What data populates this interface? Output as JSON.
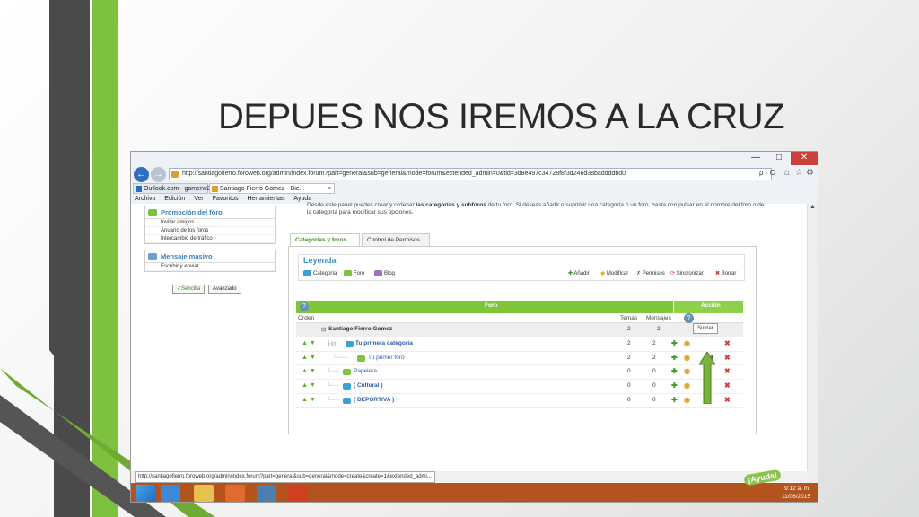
{
  "slide": {
    "title": "DEPUES NOS IREMOS A LA CRUZ"
  },
  "browser": {
    "address": "http://santiagofierro.foroweb.org/admin/index.forum?part=general&sub=general&mode=forum&extended_admin=0&tid=3d8e497c34728f8f3d246d38baddddbd0",
    "address_tools": "ρ - C",
    "tabs": [
      {
        "label": "Outlook.com - gamerw2015@..."
      },
      {
        "label": "Santiago Fierro Gomez - Bie..."
      }
    ],
    "menu": [
      "Archivo",
      "Edición",
      "Ver",
      "Favoritos",
      "Herramientas",
      "Ayuda"
    ],
    "status_url": "http://santiagofierro.foroweb.org/admin/index.forum?part=general&sub=general&mode=create&create=1&extended_admi..."
  },
  "sidebar": {
    "promo": {
      "title": "Promoción del foro",
      "items": [
        "Invitar amigos",
        "Anuario de los foros",
        "Intercambio de tráfico"
      ]
    },
    "mass": {
      "title": "Mensaje masivo",
      "items": [
        "Escribir y enviar"
      ]
    },
    "buttons": {
      "simple": "Sencilla",
      "advanced": "Avanzado"
    }
  },
  "intro": {
    "part1": "Desde este panel puedes crear y ordenar ",
    "bold": "las categorías y subforos",
    "part2": " de tu foro. Si deseas añadir o suprimir una categoría o un foro, basta con pulsar en el nombre del foro o de la categoría para modificar sus opciones."
  },
  "content_tabs": [
    "Categorías y foros",
    "Control de Permisos"
  ],
  "legend": {
    "title": "Leyenda",
    "types": [
      "Categoría",
      "Foro",
      "Blog"
    ],
    "actions": [
      "Añadir",
      "Modificar",
      "Permisos",
      "Sincronizar",
      "Borrar"
    ]
  },
  "table": {
    "header_foro": "Foro",
    "header_accion": "Acción",
    "col_orden": "Orden",
    "col_temas": "Temas",
    "col_mensajes": "Mensajes",
    "tooltip": "Sumar",
    "rows": [
      {
        "name": "Santiago Fierro Gomez",
        "temas": "2",
        "mensajes": "2"
      },
      {
        "name": "Tu primera categoría",
        "temas": "2",
        "mensajes": "2"
      },
      {
        "name": "Tu primer foro",
        "temas": "2",
        "mensajes": "2"
      },
      {
        "name": "Papelera",
        "temas": "0",
        "mensajes": "0"
      },
      {
        "name": "( Cultural )",
        "temas": "0",
        "mensajes": "0"
      },
      {
        "name": "( DEPORTIVA )",
        "temas": "0",
        "mensajes": "0"
      }
    ]
  },
  "taskbar": {
    "time": "9:12 a. m.",
    "date": "11/06/2015",
    "help_badge": "¡Ayuda!"
  },
  "colors": {
    "accent_green": "#7fc53a",
    "taskbar": "#b3541e",
    "arrow_green": "#7ab33a"
  }
}
